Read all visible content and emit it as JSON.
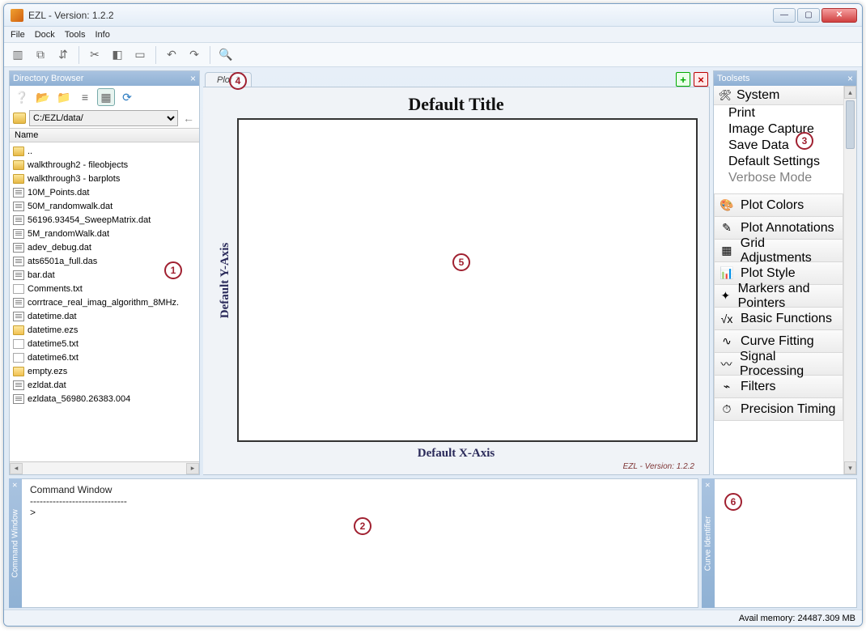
{
  "window": {
    "title": "EZL - Version: 1.2.2"
  },
  "menubar": [
    "File",
    "Dock",
    "Tools",
    "Info"
  ],
  "dir_browser": {
    "title": "Directory Browser",
    "path": "C:/EZL/data/",
    "column": "Name",
    "files": [
      {
        "name": "..",
        "type": "folder"
      },
      {
        "name": "walkthrough2 - fileobjects",
        "type": "folder"
      },
      {
        "name": "walkthrough3 - barplots",
        "type": "folder"
      },
      {
        "name": "10M_Points.dat",
        "type": "dat"
      },
      {
        "name": "50M_randomwalk.dat",
        "type": "dat"
      },
      {
        "name": "56196.93454_SweepMatrix.dat",
        "type": "dat"
      },
      {
        "name": "5M_randomWalk.dat",
        "type": "dat"
      },
      {
        "name": "adev_debug.dat",
        "type": "dat"
      },
      {
        "name": "ats6501a_full.das",
        "type": "dat"
      },
      {
        "name": "bar.dat",
        "type": "dat"
      },
      {
        "name": "Comments.txt",
        "type": "txt"
      },
      {
        "name": "corrtrace_real_imag_algorithm_8MHz.",
        "type": "dat"
      },
      {
        "name": "datetime.dat",
        "type": "dat"
      },
      {
        "name": "datetime.ezs",
        "type": "ezs"
      },
      {
        "name": "datetime5.txt",
        "type": "txt"
      },
      {
        "name": "datetime6.txt",
        "type": "txt"
      },
      {
        "name": "empty.ezs",
        "type": "ezs"
      },
      {
        "name": "ezldat.dat",
        "type": "dat"
      },
      {
        "name": "ezldata_56980.26383.004",
        "type": "dat"
      }
    ]
  },
  "plot": {
    "tab": "Plot 1",
    "title": "Default Title",
    "ylabel": "Default Y-Axis",
    "xlabel": "Default X-Axis",
    "version_label": "EZL - Version: 1.2.2"
  },
  "toolsets": {
    "title": "Toolsets",
    "system_label": "System",
    "system_items": [
      "Print",
      "Image Capture",
      "Save Data",
      "Default Settings",
      "Verbose Mode"
    ],
    "items": [
      {
        "label": "Plot Colors",
        "icon": "🎨"
      },
      {
        "label": "Plot Annotations",
        "icon": "✎"
      },
      {
        "label": "Grid Adjustments",
        "icon": "▦"
      },
      {
        "label": "Plot Style",
        "icon": "📊"
      },
      {
        "label": "Markers and Pointers",
        "icon": "✦"
      },
      {
        "label": "Basic Functions",
        "icon": "√x"
      },
      {
        "label": "Curve Fitting",
        "icon": "∿"
      },
      {
        "label": "Signal Processing",
        "icon": "〰"
      },
      {
        "label": "Filters",
        "icon": "⌁"
      },
      {
        "label": "Precision Timing",
        "icon": "⏱"
      }
    ]
  },
  "command": {
    "title": "Command Window",
    "header": "Command Window",
    "divider": "------------------------------",
    "prompt": ">"
  },
  "curve": {
    "title": "Curve Identifier"
  },
  "status": {
    "mem": "Avail memory: 24487.309 MB"
  },
  "markers": [
    "1",
    "2",
    "3",
    "4",
    "5",
    "6"
  ]
}
